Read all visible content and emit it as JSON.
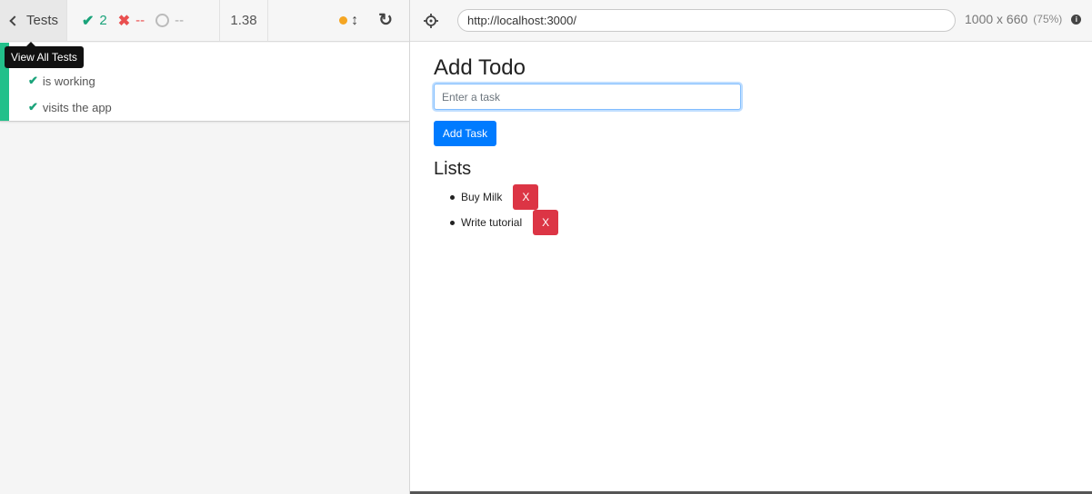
{
  "runner": {
    "tests_label": "Tests",
    "tooltip": "View All Tests",
    "stats": {
      "passed": "2",
      "failed": "--",
      "pending": "--"
    },
    "duration": "1.38",
    "tests": [
      {
        "title": "is working",
        "state": "passed"
      },
      {
        "title": "visits the app",
        "state": "passed"
      }
    ],
    "colors": {
      "pass": "#1aa37a",
      "fail": "#e94f4f",
      "stripe": "#22c08a",
      "running_dot": "#f5a623"
    }
  },
  "aut": {
    "url": "http://localhost:3000/",
    "viewport": "1000 x 660",
    "scale": "(75%)"
  },
  "app": {
    "add_title": "Add Todo",
    "input_placeholder": "Enter a task",
    "add_button": "Add Task",
    "lists_title": "Lists",
    "todos": [
      {
        "text": "Buy Milk",
        "delete_label": "X"
      },
      {
        "text": "Write tutorial",
        "delete_label": "X"
      }
    ],
    "colors": {
      "primary": "#007bff",
      "danger": "#dc3545"
    }
  }
}
